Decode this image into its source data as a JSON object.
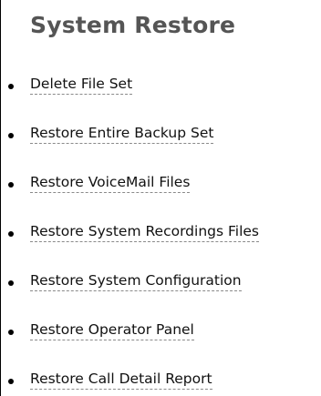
{
  "page": {
    "title": "System Restore"
  },
  "menu": {
    "items": [
      {
        "label": "Delete File Set"
      },
      {
        "label": "Restore Entire Backup Set"
      },
      {
        "label": "Restore VoiceMail Files"
      },
      {
        "label": "Restore System Recordings Files"
      },
      {
        "label": "Restore System Configuration"
      },
      {
        "label": "Restore Operator Panel"
      },
      {
        "label": "Restore Call Detail Report"
      }
    ]
  },
  "colors": {
    "title": "#555555",
    "text": "#111111",
    "underline": "#8a8a8a",
    "background": "#ffffff"
  }
}
